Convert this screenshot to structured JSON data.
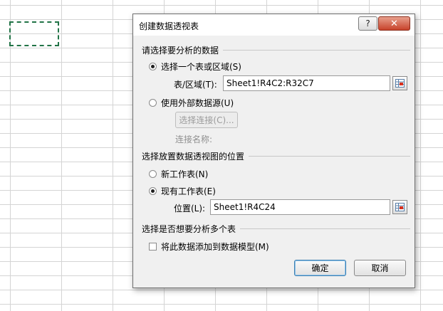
{
  "dialog": {
    "title": "创建数据透视表",
    "help_label": "?",
    "close_label": "✕",
    "section_choose_data": "请选择要分析的数据",
    "radio_select_table": "选择一个表或区域(S)",
    "table_range_label": "表/区域(T):",
    "table_range_value": "Sheet1!R4C2:R32C7",
    "radio_external": "使用外部数据源(U)",
    "choose_connection_label": "选择连接(C)...",
    "connection_name_label": "连接名称:",
    "section_location": "选择放置数据透视图的位置",
    "radio_new_sheet": "新工作表(N)",
    "radio_existing_sheet": "现有工作表(E)",
    "location_label": "位置(L):",
    "location_value": "Sheet1!R4C24",
    "section_multi": "选择是否想要分析多个表",
    "checkbox_data_model": "将此数据添加到数据模型(M)",
    "ok_label": "确定",
    "cancel_label": "取消"
  },
  "selected_source": "table_or_range",
  "selected_location": "existing_sheet",
  "data_model_checked": false,
  "icons": {
    "range_selector": "range-selector-icon"
  },
  "colors": {
    "marquee": "#217346",
    "close_button": "#c7432b",
    "default_button_border": "#3c7fb1"
  }
}
